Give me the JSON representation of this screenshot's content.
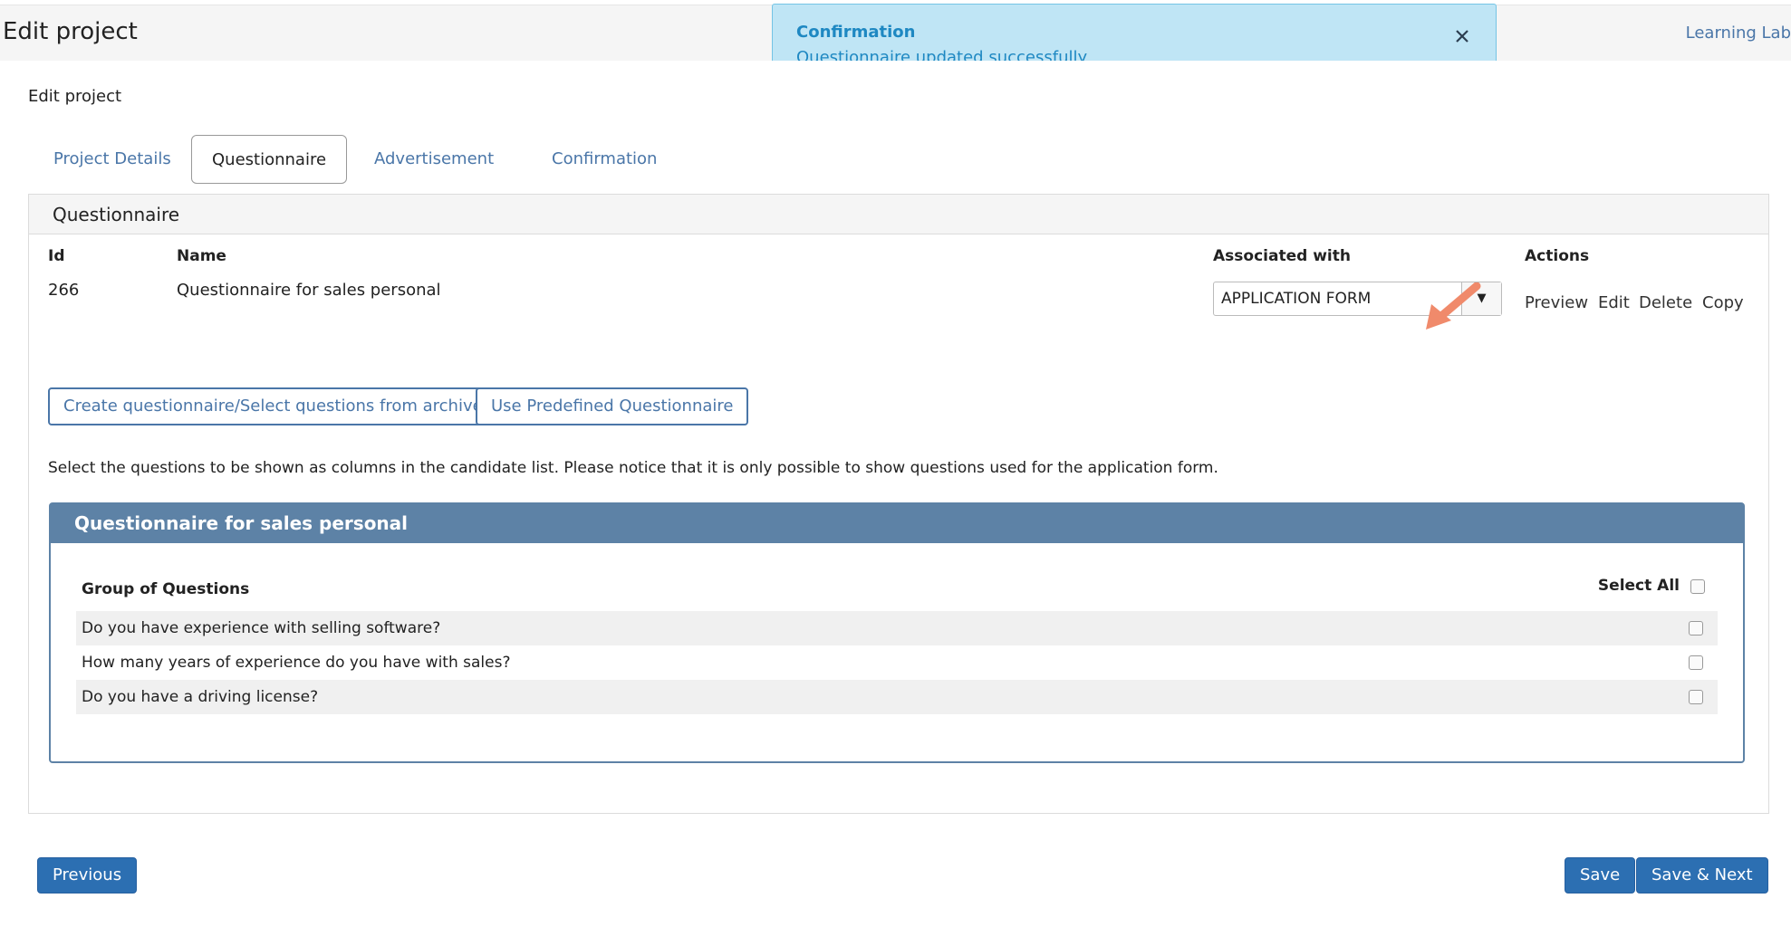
{
  "header": {
    "title": "Edit project",
    "brand_link": "Learning Lab"
  },
  "toast": {
    "title": "Confirmation",
    "message": "Questionnaire updated successfully",
    "close_icon": "close-icon"
  },
  "page": {
    "subheading": "Edit project"
  },
  "tabs": [
    {
      "label": "Project Details",
      "active": false
    },
    {
      "label": "Questionnaire",
      "active": true
    },
    {
      "label": "Advertisement",
      "active": false
    },
    {
      "label": "Confirmation",
      "active": false
    }
  ],
  "panel": {
    "title": "Questionnaire",
    "columns": {
      "id": "Id",
      "name": "Name",
      "associated": "Associated with",
      "actions": "Actions"
    },
    "row": {
      "id": "266",
      "name": "Questionnaire for sales personal",
      "associated_value": "APPLICATION FORM",
      "dropdown_icon": "chevron-down-icon",
      "actions": [
        "Preview",
        "Edit",
        "Delete",
        "Copy"
      ]
    },
    "buttons": {
      "create": "Create questionnaire/Select questions from archive",
      "predefined": "Use Predefined Questionnaire"
    },
    "help_text": "Select the questions to be shown as columns in the candidate list. Please notice that it is only possible to show questions used for the application form."
  },
  "question_panel": {
    "title": "Questionnaire for sales personal",
    "group_label": "Group of Questions",
    "select_all_label": "Select All",
    "questions": [
      {
        "text": "Do you have experience with selling software?",
        "checked": false
      },
      {
        "text": "How many years of experience do you have with sales?",
        "checked": false
      },
      {
        "text": "Do you have a driving license?",
        "checked": false
      }
    ]
  },
  "footer": {
    "previous": "Previous",
    "save": "Save",
    "save_next": "Save & Next"
  },
  "colors": {
    "link": "#4a76a8",
    "primary": "#2c6fb2",
    "panel_header": "#5d82a6",
    "toast_bg": "#bfe5f5",
    "toast_text": "#1e88c2",
    "annotation_arrow": "#f08a6b"
  }
}
